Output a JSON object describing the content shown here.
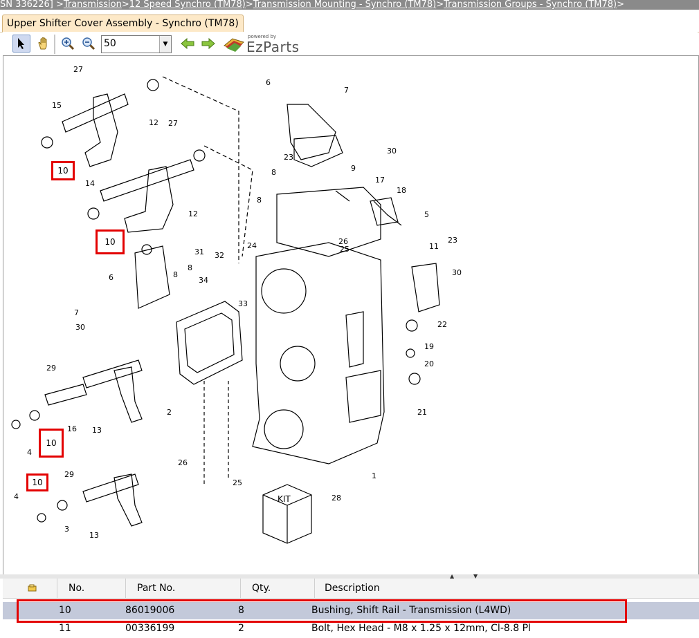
{
  "breadcrumb": {
    "prefix": "SN 336226] > ",
    "items": [
      "Transmission",
      "12 Speed Synchro (TM78)",
      "Transmission Mounting - Synchro (TM78)",
      "Transmission Groups - Synchro (TM78)"
    ],
    "sep": " > "
  },
  "tab": {
    "label": "Upper Shifter Cover Assembly - Synchro (TM78)"
  },
  "toolbar": {
    "zoom_value": "50",
    "logo_small": "powered by",
    "logo_name": "EzParts",
    "icons": [
      "pointer-icon",
      "hand-icon",
      "zoom-in-icon",
      "zoom-out-icon",
      "back-arrow-icon",
      "forward-arrow-icon",
      "ezparts-logo-icon"
    ]
  },
  "diagram": {
    "callouts": [
      "10",
      "10",
      "10",
      "10"
    ],
    "labels": [
      "27",
      "15",
      "12",
      "27",
      "14",
      "12",
      "10",
      "6",
      "7",
      "23",
      "30",
      "9",
      "8",
      "17",
      "18",
      "8",
      "5",
      "11",
      "26",
      "25",
      "23",
      "24",
      "31",
      "32",
      "8",
      "34",
      "33",
      "6",
      "7",
      "8",
      "30",
      "22",
      "19",
      "20",
      "21",
      "29",
      "16",
      "13",
      "2",
      "4",
      "3",
      "29",
      "13",
      "26",
      "25",
      "1",
      "28"
    ],
    "kit_label": "KIT"
  },
  "table": {
    "headers": [
      "No.",
      "Part No.",
      "Qty.",
      "Description"
    ],
    "rows": [
      {
        "no": "10",
        "part": "86019006",
        "qty": "8",
        "desc": "Bushing, Shift Rail - Transmission (L4WD)",
        "selected": true
      },
      {
        "no": "11",
        "part": "00336199",
        "qty": "2",
        "desc": "Bolt, Hex Head - M8 x 1.25 x 12mm, Cl-8.8 Pl",
        "selected": false
      }
    ]
  },
  "colors": {
    "highlight": "#e30000",
    "selected_row": "#c3c9da",
    "tab_bg": "#fde9c8"
  }
}
